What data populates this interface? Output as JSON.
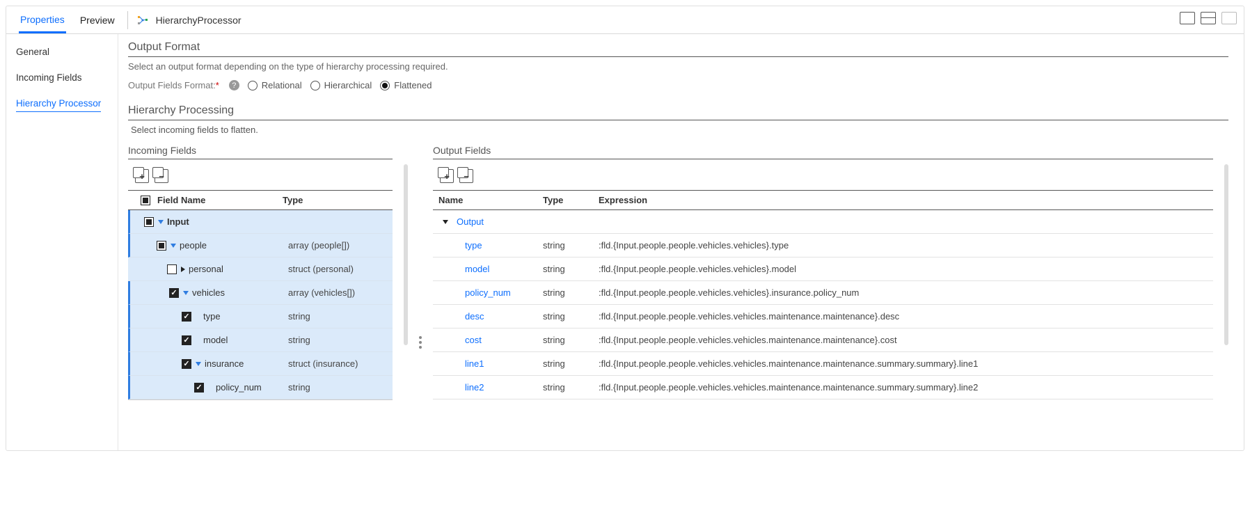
{
  "top_tabs": {
    "properties": "Properties",
    "preview": "Preview"
  },
  "title": "HierarchyProcessor",
  "side_nav": {
    "general": "General",
    "incoming": "Incoming Fields",
    "hierarchy": "Hierarchy Processor"
  },
  "output_format": {
    "heading": "Output Format",
    "help": "Select an output format depending on the type of hierarchy processing required.",
    "label": "Output Fields Format:",
    "options": {
      "relational": "Relational",
      "hierarchical": "Hierarchical",
      "flattened": "Flattened"
    }
  },
  "hierarchy_processing": {
    "heading": "Hierarchy Processing",
    "help": "Select incoming fields to flatten."
  },
  "columns": {
    "incoming_title": "Incoming Fields",
    "output_title": "Output Fields"
  },
  "incoming": {
    "headers": {
      "field": "Field Name",
      "type": "Type"
    },
    "rows": [
      {
        "indent": 0,
        "check": "partial",
        "tri": "down",
        "name": "Input",
        "bold": true,
        "type": "",
        "sel": true,
        "bar": true
      },
      {
        "indent": 1,
        "check": "partial",
        "tri": "down",
        "name": "people",
        "type": "array (people[])",
        "sel": true,
        "bar": true
      },
      {
        "indent": 2,
        "check": "empty",
        "tri": "right",
        "name": "personal",
        "type": "struct (personal)",
        "sel": true,
        "bar": false
      },
      {
        "indent": 2,
        "check": "checked",
        "tri": "down",
        "name": "vehicles",
        "type": "array (vehicles[])",
        "sel": true,
        "bar": true
      },
      {
        "indent": 3,
        "check": "checked",
        "tri": "",
        "name": "type",
        "type": "string",
        "sel": true,
        "bar": true
      },
      {
        "indent": 3,
        "check": "checked",
        "tri": "",
        "name": "model",
        "type": "string",
        "sel": true,
        "bar": true
      },
      {
        "indent": 3,
        "check": "checked",
        "tri": "down",
        "name": "insurance",
        "type": "struct (insurance)",
        "sel": true,
        "bar": true
      },
      {
        "indent": 4,
        "check": "checked",
        "tri": "",
        "name": "policy_num",
        "type": "string",
        "sel": true,
        "bar": true
      }
    ]
  },
  "output": {
    "headers": {
      "name": "Name",
      "type": "Type",
      "expr": "Expression"
    },
    "root": "Output",
    "rows": [
      {
        "name": "type",
        "type": "string",
        "expr": ":fld.{Input.people.people.vehicles.vehicles}.type"
      },
      {
        "name": "model",
        "type": "string",
        "expr": ":fld.{Input.people.people.vehicles.vehicles}.model"
      },
      {
        "name": "policy_num",
        "type": "string",
        "expr": ":fld.{Input.people.people.vehicles.vehicles}.insurance.policy_num"
      },
      {
        "name": "desc",
        "type": "string",
        "expr": ":fld.{Input.people.people.vehicles.vehicles.maintenance.maintenance}.desc"
      },
      {
        "name": "cost",
        "type": "string",
        "expr": ":fld.{Input.people.people.vehicles.vehicles.maintenance.maintenance}.cost"
      },
      {
        "name": "line1",
        "type": "string",
        "expr": ":fld.{Input.people.people.vehicles.vehicles.maintenance.maintenance.summary.summary}.line1"
      },
      {
        "name": "line2",
        "type": "string",
        "expr": ":fld.{Input.people.people.vehicles.vehicles.maintenance.maintenance.summary.summary}.line2"
      }
    ]
  }
}
